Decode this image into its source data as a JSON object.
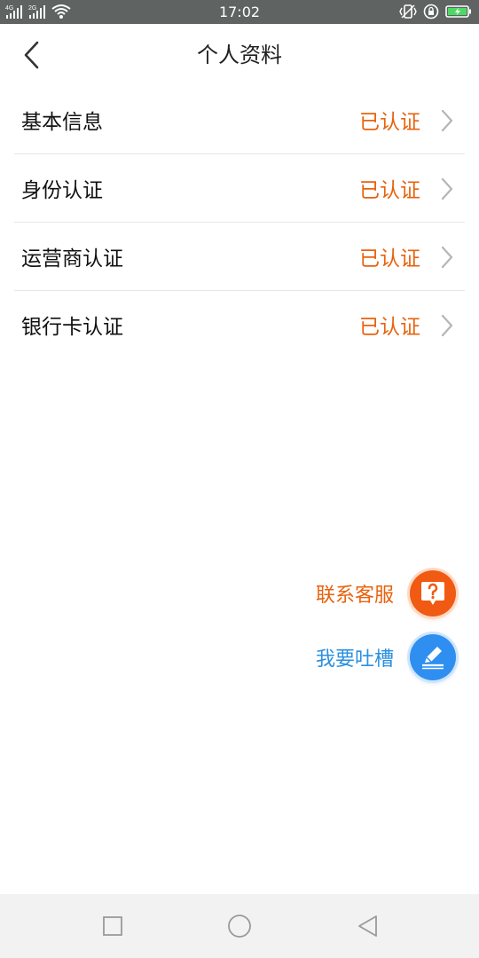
{
  "status_bar": {
    "time": "17:02",
    "network_1": "4G",
    "network_2": "2G",
    "icons": [
      "signal-icon",
      "signal-icon",
      "wifi-icon",
      "vibrate-icon",
      "rotation-lock-icon",
      "battery-charging-icon"
    ],
    "battery_color": "#4cd964"
  },
  "header": {
    "title": "个人资料",
    "back_icon": "back-arrow-icon"
  },
  "list": {
    "items": [
      {
        "label": "基本信息",
        "status": "已认证"
      },
      {
        "label": "身份认证",
        "status": "已认证"
      },
      {
        "label": "运营商认证",
        "status": "已认证"
      },
      {
        "label": "银行卡认证",
        "status": "已认证"
      }
    ],
    "status_color": "#e8620c"
  },
  "actions": {
    "customer_service": {
      "label": "联系客服",
      "icon": "help-chat-icon",
      "color": "#f05a12"
    },
    "feedback": {
      "label": "我要吐槽",
      "icon": "edit-pen-icon",
      "color": "#2f8ff0"
    }
  },
  "nav_bar": {
    "icons": [
      "recent-apps-icon",
      "home-icon",
      "back-icon"
    ]
  }
}
